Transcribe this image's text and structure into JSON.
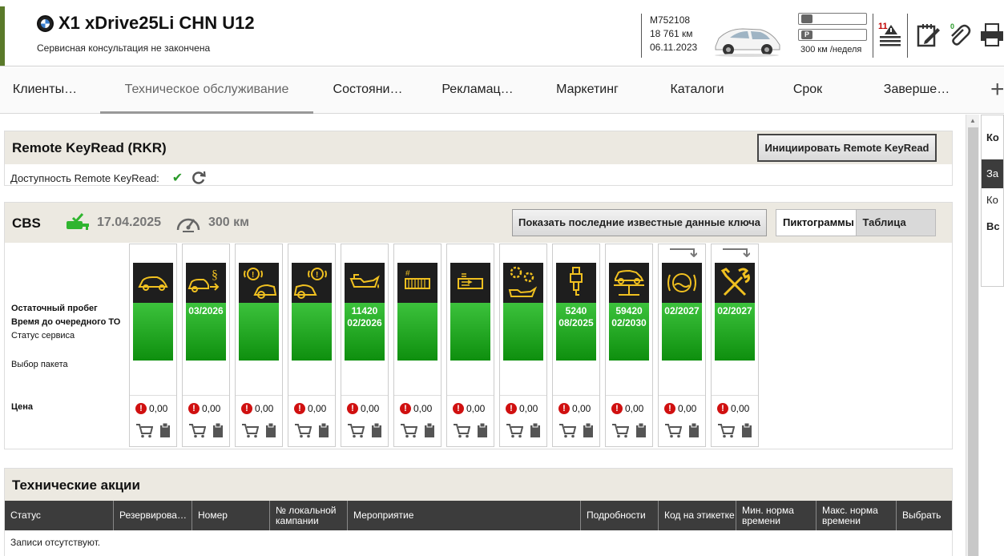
{
  "header": {
    "model": "X1 xDrive25Li CHN U12",
    "consultation_status": "Сервисная консультация не закончена",
    "vehicle_code": "M752108",
    "mileage": "18 761 км",
    "date": "06.11.2023",
    "km_per_week": "300 км /неделя",
    "notification_count": "11",
    "fuel_icon_label": "P"
  },
  "nav": {
    "tabs": [
      {
        "label": "Клиенты…"
      },
      {
        "label": "Техническое обслуживание"
      },
      {
        "label": "Состояни…"
      },
      {
        "label": "Рекламац…"
      },
      {
        "label": "Маркетинг"
      },
      {
        "label": "Каталоги"
      },
      {
        "label": "Срок"
      },
      {
        "label": "Заверше…"
      }
    ],
    "active_tab": "Техническое обслуживание"
  },
  "rkr": {
    "title": "Remote KeyRead (RKR)",
    "init_button": "Инициировать Remote KeyRead",
    "availability_label": "Доступность Remote KeyRead:"
  },
  "cbs": {
    "title": "CBS",
    "date": "17.04.2025",
    "km": "300 км",
    "show_key_button": "Показать последние известные данные ключа",
    "view_pictograms": "Пиктограммы",
    "view_table": "Таблица",
    "row_labels": {
      "remaining_mileage": "Остаточный пробег",
      "time_to_service": "Время до очередного ТО",
      "service_status": "Статус сервиса",
      "package_select": "Выбор пакета",
      "price": "Цена"
    },
    "items": [
      {
        "icon": "car-check-icon",
        "line1": "",
        "line2": "",
        "price": "0,00",
        "arrow": false
      },
      {
        "icon": "car-inspection-legal-icon",
        "line1": "",
        "line2": "03/2026",
        "price": "0,00",
        "arrow": false
      },
      {
        "icon": "brake-front-icon",
        "line1": "",
        "line2": "",
        "price": "0,00",
        "arrow": false
      },
      {
        "icon": "brake-rear-icon",
        "line1": "",
        "line2": "",
        "price": "0,00",
        "arrow": false
      },
      {
        "icon": "engine-oil-icon",
        "line1": "11420",
        "line2": "02/2026",
        "price": "0,00",
        "arrow": false
      },
      {
        "icon": "cabin-filter-icon",
        "line1": "",
        "line2": "",
        "price": "0,00",
        "arrow": false
      },
      {
        "icon": "air-filter-icon",
        "line1": "",
        "line2": "",
        "price": "0,00",
        "arrow": false
      },
      {
        "icon": "transmission-oil-icon",
        "line1": "",
        "line2": "",
        "price": "0,00",
        "arrow": false
      },
      {
        "icon": "spark-plug-icon",
        "line1": "5240",
        "line2": "08/2025",
        "price": "0,00",
        "arrow": false
      },
      {
        "icon": "vehicle-lift-icon",
        "line1": "59420",
        "line2": "02/2030",
        "price": "0,00",
        "arrow": false
      },
      {
        "icon": "brake-fluid-icon",
        "line1": "",
        "line2": "02/2027",
        "price": "0,00",
        "arrow": true
      },
      {
        "icon": "service-tools-icon",
        "line1": "",
        "line2": "02/2027",
        "price": "0,00",
        "arrow": true
      }
    ]
  },
  "tech_actions": {
    "title": "Технические акции",
    "columns": [
      "Статус",
      "Резервирова…",
      "Номер",
      "№ локальной кампании",
      "Мероприятие",
      "Подробности",
      "Код на этикетке",
      "Мин. норма времени",
      "Макс. норма времени",
      "Выбрать"
    ],
    "empty_text": "Записи отсутствуют."
  },
  "side_panel": {
    "line1": "Ко",
    "line2": "За",
    "line3": "Ко",
    "line4": "Вс"
  },
  "colors": {
    "accent_green": "#5a7a2a",
    "cbs_green": "#2fb52f",
    "icon_yellow": "#f0c020",
    "warning_red": "#d01010"
  }
}
